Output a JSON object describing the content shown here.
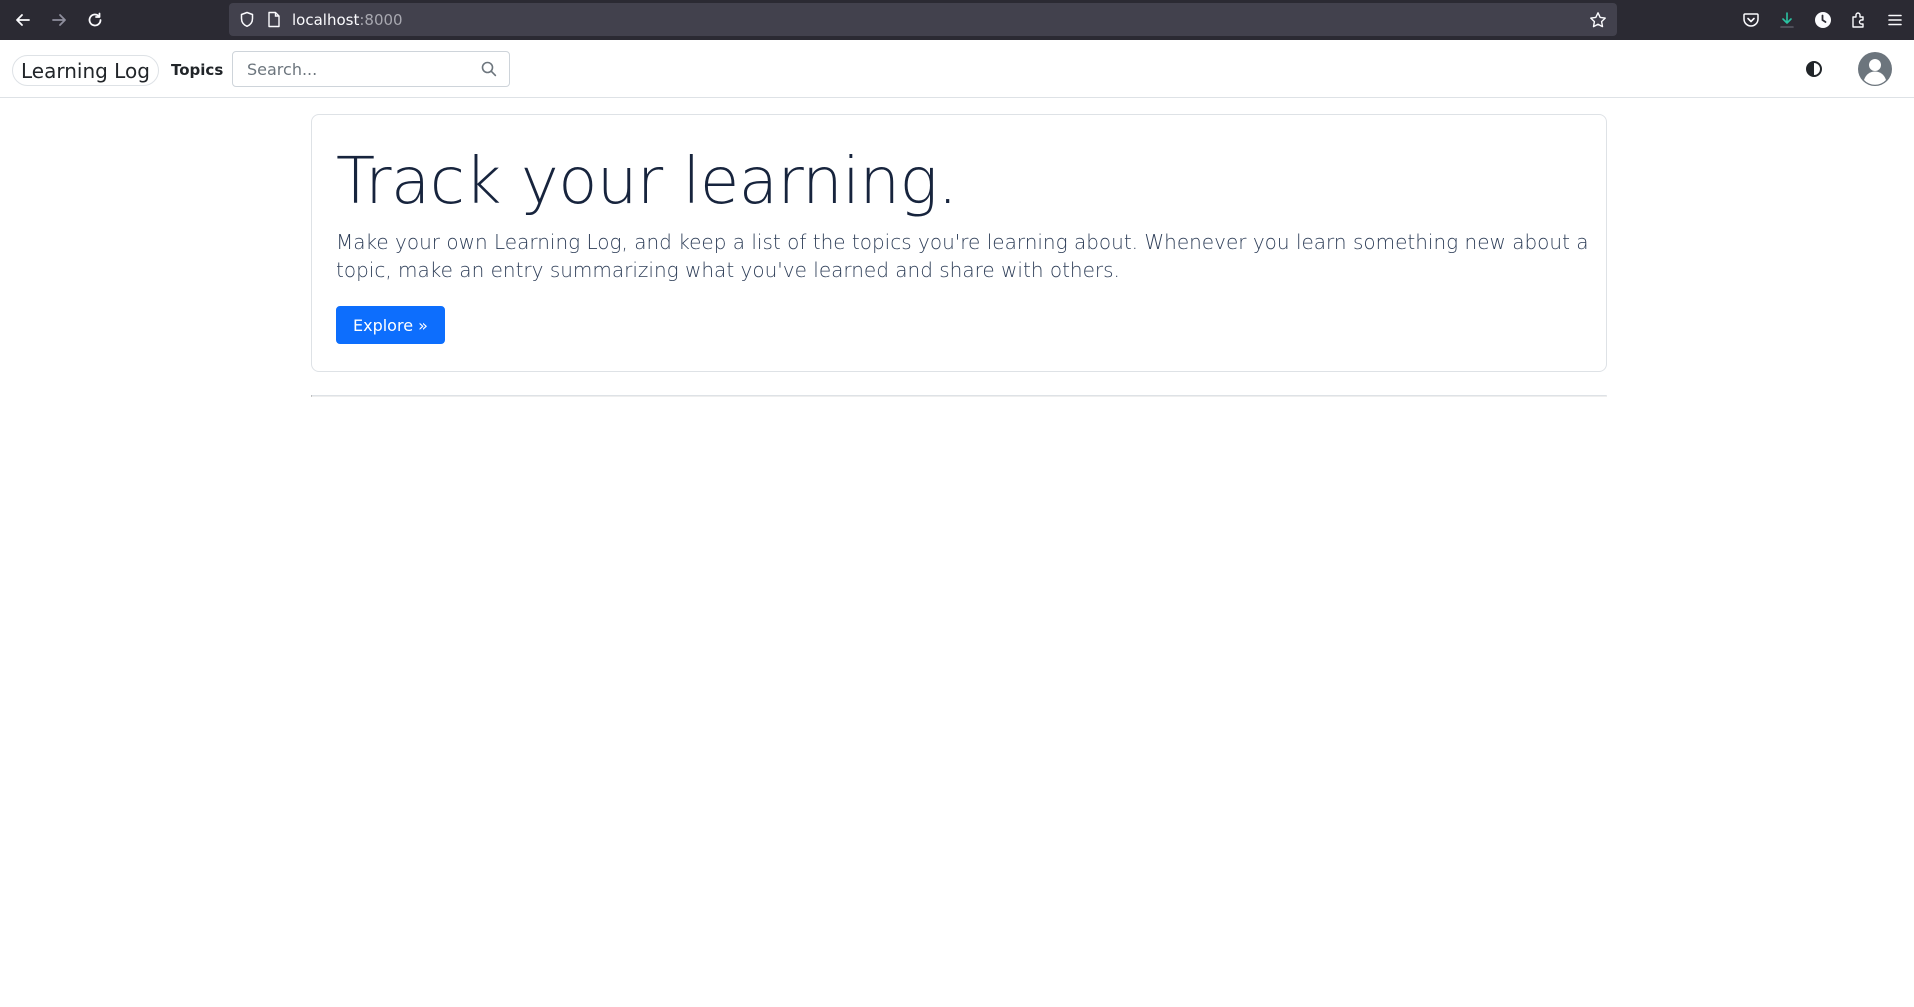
{
  "browser": {
    "url_host": "localhost",
    "url_port": ":8000",
    "icons": [
      "back-arrow-icon",
      "forward-arrow-icon",
      "reload-icon",
      "shield-icon",
      "page-icon",
      "bookmark-star-icon",
      "pocket-icon",
      "download-icon",
      "account-icon",
      "extensions-icon",
      "menu-icon"
    ]
  },
  "navbar": {
    "brand": "Learning Log",
    "topics_link": "Topics",
    "search_placeholder": "Search..."
  },
  "hero": {
    "title": "Track your learning.",
    "text": "Make your own Learning Log, and keep a list of the topics you're learning about. Whenever you learn something new about a topic, make an entry summarizing what you've learned and share with others.",
    "button": "Explore »"
  },
  "colors": {
    "accent": "#0d6efd",
    "title": "#17243d",
    "browser_bar": "#2b2a33"
  }
}
